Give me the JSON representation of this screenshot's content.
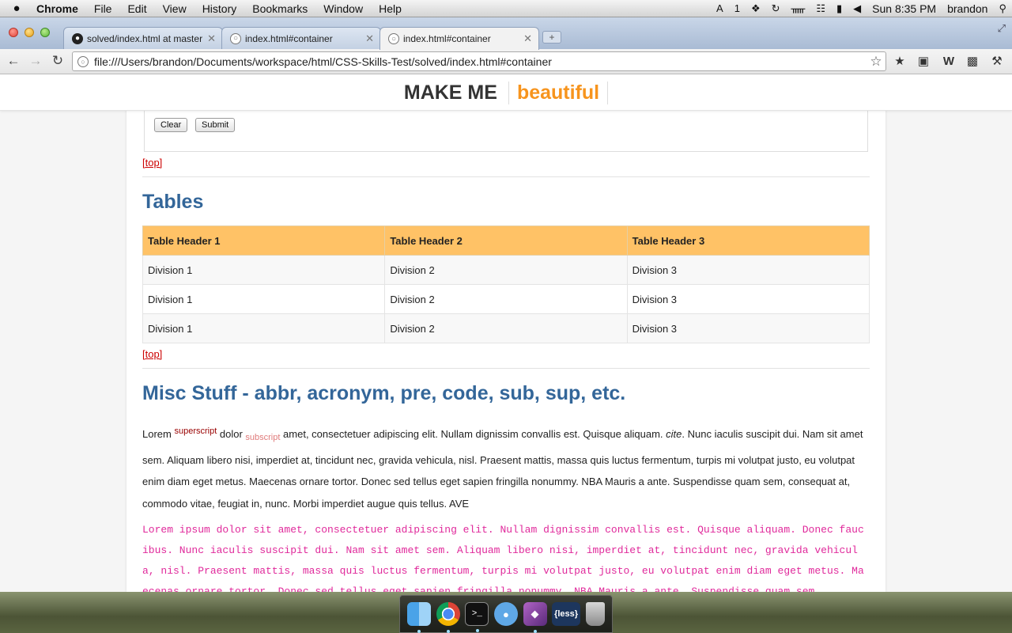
{
  "menubar": {
    "apple": "",
    "items": [
      "Chrome",
      "File",
      "Edit",
      "View",
      "History",
      "Bookmarks",
      "Window",
      "Help"
    ],
    "status": {
      "adobe": "A",
      "count": "1",
      "datetime": "Sun 8:35 PM",
      "user": "brandon"
    }
  },
  "browser": {
    "tabs": [
      {
        "title": "solved/index.html at master",
        "favicon": "github-icon"
      },
      {
        "title": "index.html#container",
        "favicon": "globe-icon"
      },
      {
        "title": "index.html#container",
        "favicon": "globe-icon"
      }
    ],
    "active_tab": 2,
    "newtab_label": "+",
    "url": "file:///Users/brandon/Documents/workspace/html/CSS-Skills-Test/solved/index.html#container"
  },
  "site": {
    "brand_left": "MAKE ME",
    "brand_right": "beautiful",
    "brand_color": "#f7941d"
  },
  "form": {
    "clear_label": "Clear",
    "submit_label": "Submit"
  },
  "top_link": "[top]",
  "tables_section": {
    "heading": "Tables",
    "headers": [
      "Table Header 1",
      "Table Header 2",
      "Table Header 3"
    ],
    "rows": [
      [
        "Division 1",
        "Division 2",
        "Division 3"
      ],
      [
        "Division 1",
        "Division 2",
        "Division 3"
      ],
      [
        "Division 1",
        "Division 2",
        "Division 3"
      ]
    ],
    "header_color": "#ffc266"
  },
  "misc_section": {
    "heading": "Misc Stuff - abbr, acronym, pre, code, sub, sup, etc.",
    "p_start": "Lorem ",
    "sup": "superscript",
    "p_mid1": " dolor ",
    "sub": "subscript",
    "p_mid2": " amet, consectetuer adipiscing elit. Nullam dignissim convallis est. Quisque aliquam. ",
    "cite": "cite",
    "p_end": ". Nunc iaculis suscipit dui. Nam sit amet sem. Aliquam libero nisi, imperdiet at, tincidunt nec, gravida vehicula, nisl. Praesent mattis, massa quis luctus fermentum, turpis mi volutpat justo, eu volutpat enim diam eget metus. Maecenas ornare tortor. Donec sed tellus eget sapien fringilla nonummy. NBA Mauris a ante. Suspendisse quam sem, consequat at, commodo vitae, feugiat in, nunc. Morbi imperdiet augue quis tellus. AVE",
    "pre": "Lorem ipsum dolor sit amet, consectetuer adipiscing elit. Nullam dignissim convallis est. Quisque aliquam. Donec faucibus. Nunc iaculis suscipit dui. Nam sit amet sem. Aliquam libero nisi, imperdiet at, tincidunt nec, gravida vehicula, nisl. Praesent mattis, massa quis luctus fermentum, turpis mi volutpat justo, eu volutpat enim diam eget metus. Maecenas ornare tortor. Donec sed tellus eget sapien fringilla nonummy. NBA Mauris a ante. Suspendisse quam sem,",
    "pre_color": "#e0299b"
  },
  "dock": {
    "items": [
      "finder-icon",
      "chrome-icon",
      "terminal-icon",
      "facetime-icon",
      "app-icon",
      "less-icon",
      "trash-icon"
    ],
    "less_label": "{less}"
  }
}
